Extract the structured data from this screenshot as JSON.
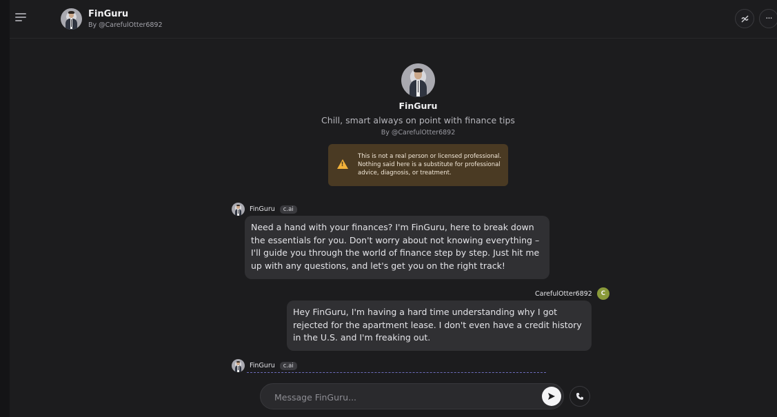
{
  "header": {
    "title": "FinGuru",
    "byline": "By @CarefulOtter6892"
  },
  "intro": {
    "name": "FinGuru",
    "tagline": "Chill, smart always on point with finance tips",
    "byline": "By @CarefulOtter6892"
  },
  "disclaimer": {
    "text": "This is not a real person or licensed professional. Nothing said here is a substitute for professional advice, diagnosis, or treatment."
  },
  "messages": [
    {
      "author": "FinGuru",
      "badge": "c.ai",
      "text": "Need a hand with your finances? I'm FinGuru, here to break down the essentials for you. Don't worry about not knowing everything – I'll guide you through the world of finance step by step. Just hit me up with any questions, and let's get you on the right track!"
    },
    {
      "author": "CarefulOtter6892",
      "avatar_letter": "C",
      "text": "Hey FinGuru, I'm having a hard time understanding why I got rejected for the apartment lease. I don't even have a credit history in the U.S. and I'm freaking out."
    },
    {
      "author": "FinGuru",
      "badge": "c.ai"
    }
  ],
  "composer": {
    "placeholder": "Message FinGuru..."
  },
  "icons": {
    "menu": "menu-icon",
    "mute": "mute-voice-icon",
    "more": "more-icon",
    "warning": "warning-icon",
    "send": "send-icon",
    "call": "phone-icon"
  },
  "colors": {
    "background": "#1c1c1e",
    "bubble": "#303033",
    "disclaimer": "#4a3a23",
    "warning": "#f2b23a",
    "user_avatar": "#8a9a3a"
  }
}
